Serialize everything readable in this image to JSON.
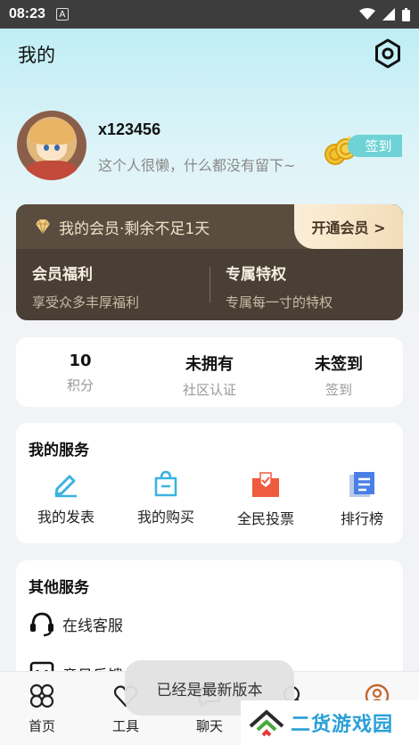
{
  "status_bar": {
    "time": "08:23",
    "notification_glyph": "A"
  },
  "header": {
    "title": "我的"
  },
  "profile": {
    "username": "x123456",
    "bio": "这个人很懒，什么都没有留下~",
    "signin_label": "签到"
  },
  "vip": {
    "status_text": "我的会员·剩余不足1天",
    "open_button": "开通会员 >",
    "benefits": [
      {
        "title": "会员福利",
        "subtitle": "享受众多丰厚福利"
      },
      {
        "title": "专属特权",
        "subtitle": "专属每一寸的特权"
      }
    ]
  },
  "stats": [
    {
      "value": "10",
      "label": "积分"
    },
    {
      "value": "未拥有",
      "label": "社区认证"
    },
    {
      "value": "未签到",
      "label": "签到"
    }
  ],
  "my_services": {
    "title": "我的服务",
    "items": [
      {
        "label": "我的发表",
        "icon": "edit-icon"
      },
      {
        "label": "我的购买",
        "icon": "shopping-bag-icon"
      },
      {
        "label": "全民投票",
        "icon": "vote-icon"
      },
      {
        "label": "排行榜",
        "icon": "ranking-icon"
      }
    ]
  },
  "other_services": {
    "title": "其他服务",
    "items": [
      {
        "label": "在线客服",
        "icon": "headset-icon"
      },
      {
        "label": "意见反馈",
        "icon": "feedback-icon"
      }
    ]
  },
  "tabbar": {
    "items": [
      {
        "label": "首页",
        "icon": "home-icon"
      },
      {
        "label": "工具",
        "icon": "tools-icon"
      },
      {
        "label": "聊天",
        "icon": "chat-icon"
      },
      {
        "label": "",
        "icon": "community-icon"
      },
      {
        "label": "",
        "icon": "profile-icon"
      }
    ]
  },
  "toast": {
    "text": "已经是最新版本"
  },
  "watermark": {
    "text": "二货游戏园"
  },
  "colors": {
    "accent_teal": "#6fd2d6",
    "vip_bg": "#4a3f35",
    "vote_red": "#ef5b3f",
    "rank_blue": "#4a7fe6",
    "edit_blue": "#3bb3e0"
  }
}
